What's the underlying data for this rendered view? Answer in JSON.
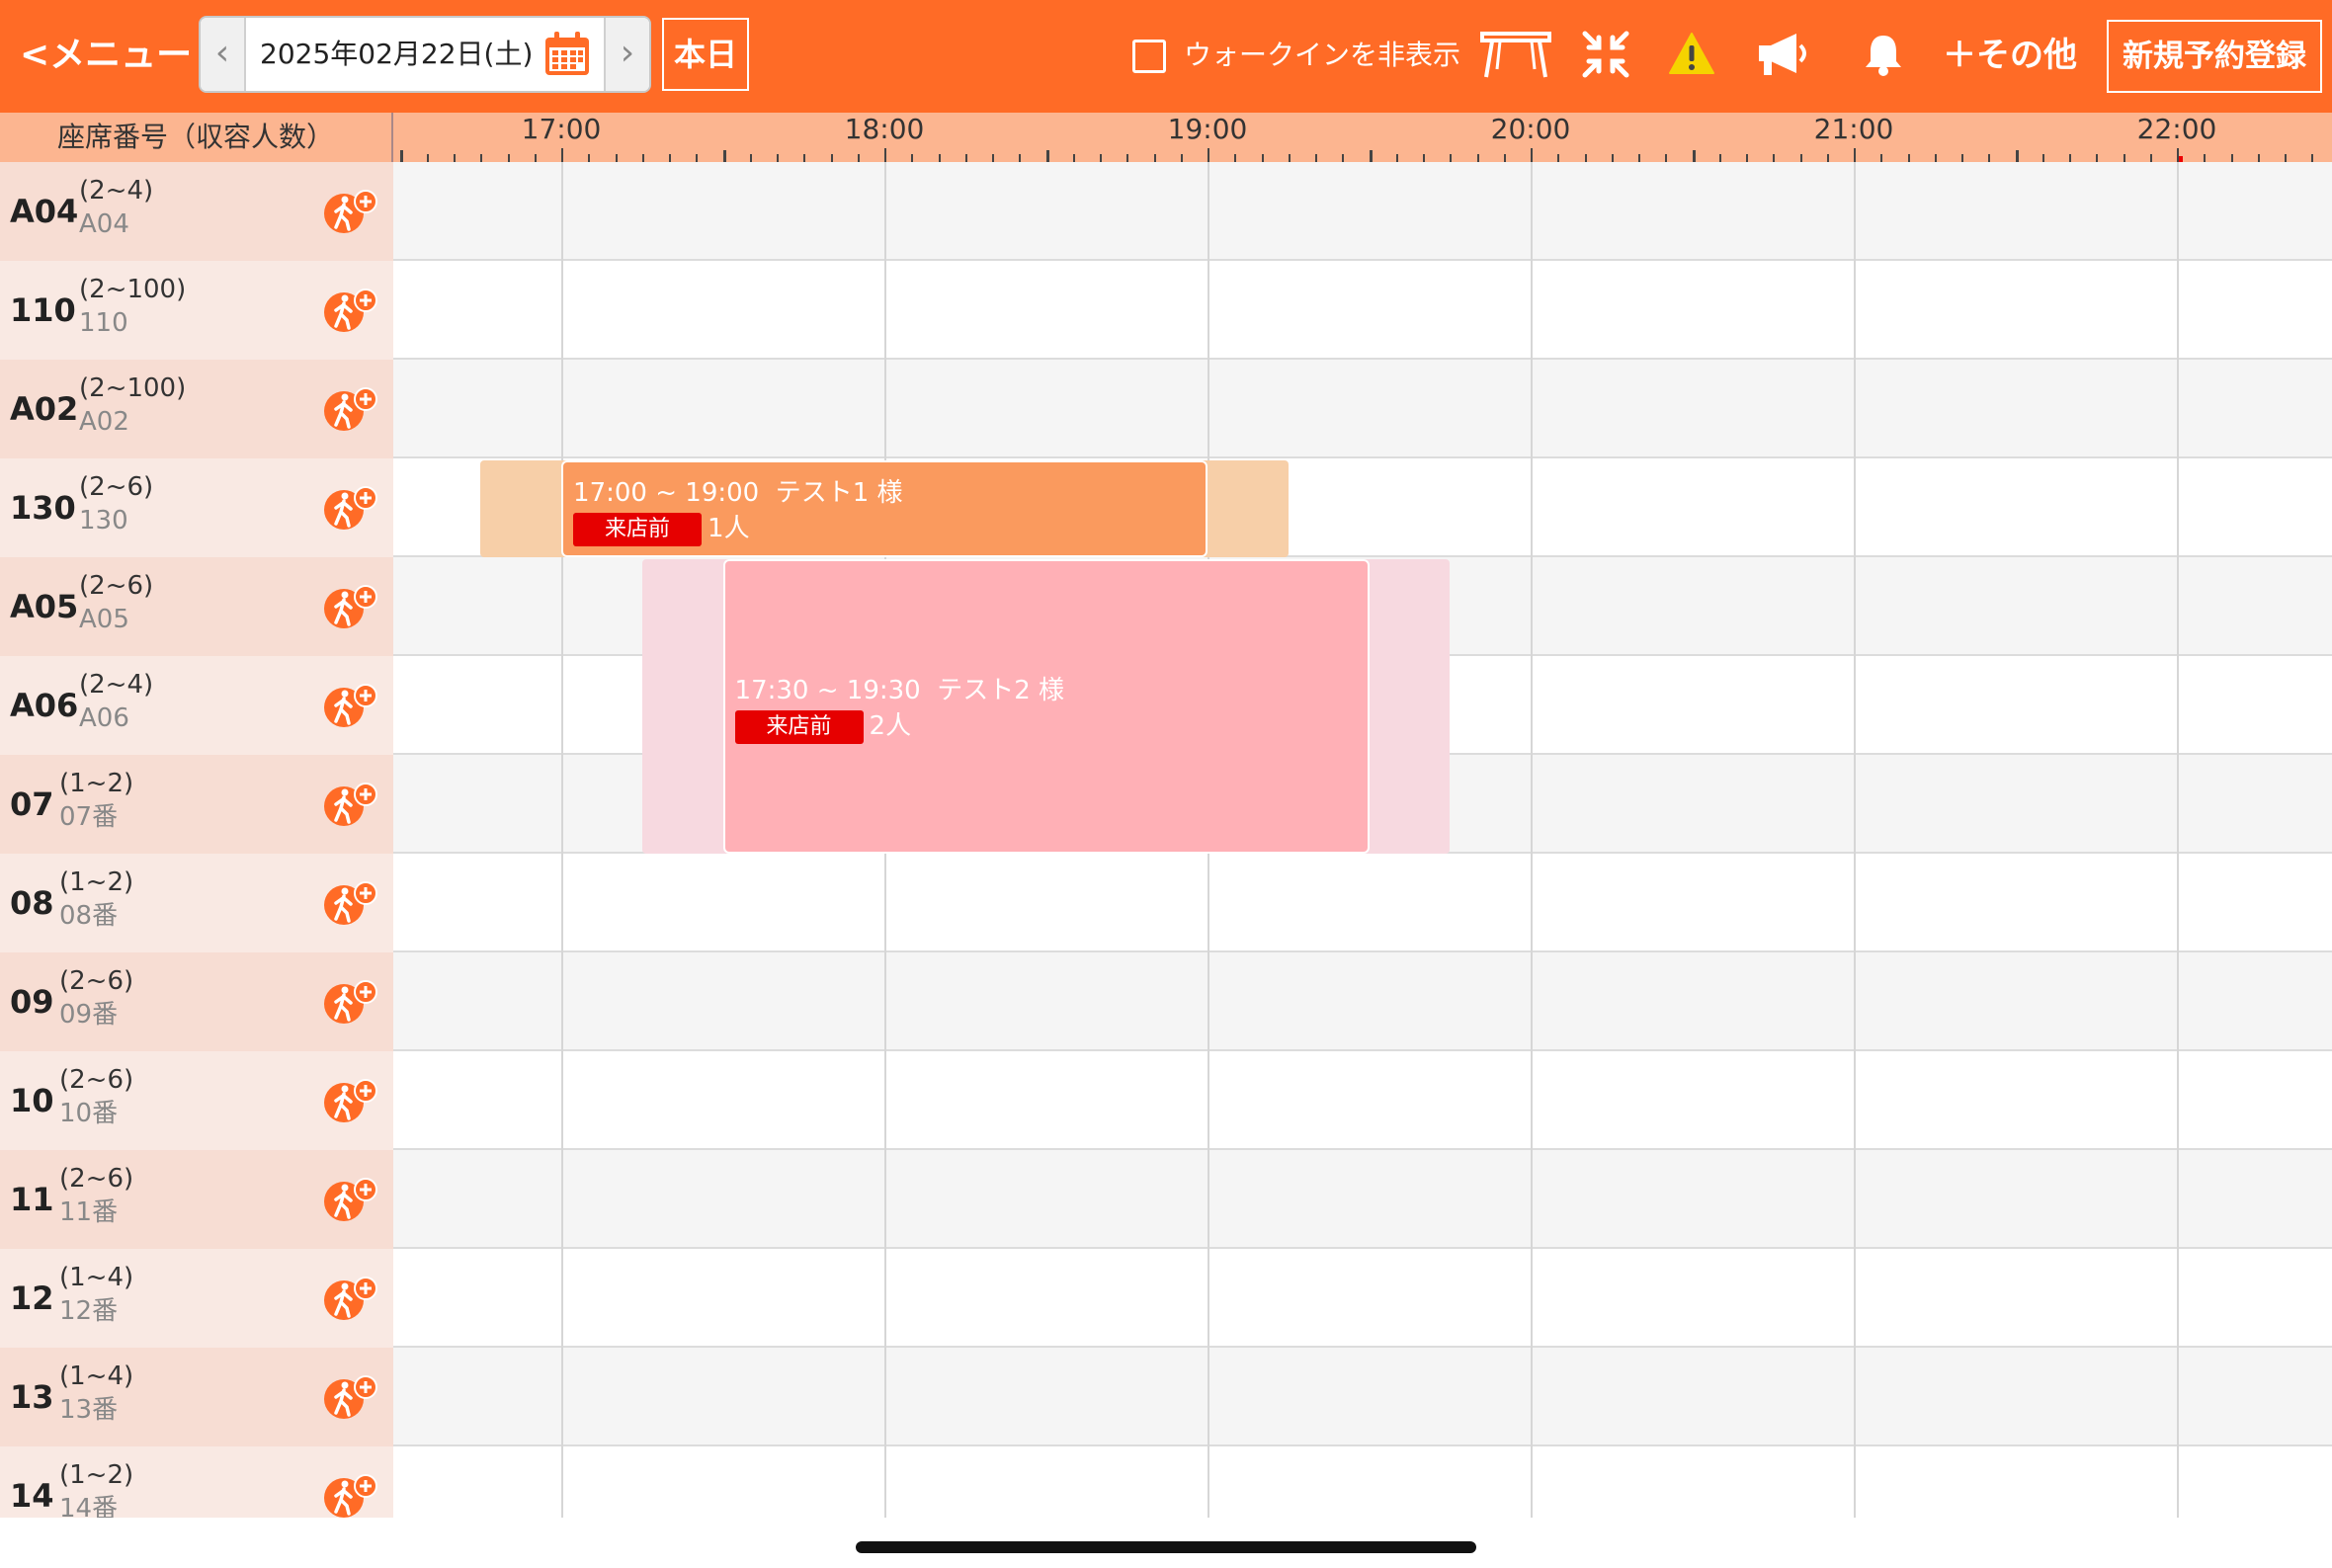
{
  "topbar": {
    "menu_label": "<メニュー",
    "date": "2025年02月22日(土)",
    "today_label": "本日",
    "walkin_hide_label": "ウォークインを非表示",
    "walkin_hide_checked": false,
    "other_label": "その他",
    "new_reservation_label": "新規予約登録",
    "icons": [
      "chevron-left-icon",
      "chevron-right-icon",
      "calendar-icon",
      "table-icon",
      "collapse-icon",
      "warning-icon",
      "megaphone-icon",
      "bell-icon",
      "plus-icon"
    ]
  },
  "timeline": {
    "seat_header": "座席番号（収容人数）",
    "hours": [
      "17:00",
      "18:00",
      "19:00",
      "20:00",
      "21:00",
      "22:00"
    ],
    "start_hour": 16.48,
    "end_hour": 22.53,
    "now": "22:00"
  },
  "seats": [
    {
      "name": "A04",
      "capacity": "(2~4)",
      "sub": "A04"
    },
    {
      "name": "110",
      "capacity": "(2~100)",
      "sub": "110"
    },
    {
      "name": "A02",
      "capacity": "(2~100)",
      "sub": "A02"
    },
    {
      "name": "130",
      "capacity": "(2~6)",
      "sub": "130"
    },
    {
      "name": "A05",
      "capacity": "(2~6)",
      "sub": "A05"
    },
    {
      "name": "A06",
      "capacity": "(2~4)",
      "sub": "A06"
    },
    {
      "name": "07",
      "capacity": "(1~2)",
      "sub": "07番"
    },
    {
      "name": "08",
      "capacity": "(1~2)",
      "sub": "08番"
    },
    {
      "name": "09",
      "capacity": "(2~6)",
      "sub": "09番"
    },
    {
      "name": "10",
      "capacity": "(2~6)",
      "sub": "10番"
    },
    {
      "name": "11",
      "capacity": "(2~6)",
      "sub": "11番"
    },
    {
      "name": "12",
      "capacity": "(1~4)",
      "sub": "12番"
    },
    {
      "name": "13",
      "capacity": "(1~4)",
      "sub": "13番"
    },
    {
      "name": "14",
      "capacity": "(1~2)",
      "sub": "14番"
    }
  ],
  "reservations": [
    {
      "time": "17:00 ~ 19:00",
      "guest": "テスト1 様",
      "status": "来店前",
      "party": "1人",
      "start_hour": 17.0,
      "end_hour": 19.0,
      "buffer_start_hour": 16.75,
      "buffer_end_hour": 19.25,
      "seats": [
        "130"
      ],
      "color": "#fa9a5e",
      "buffer_color": "#f7cfa8"
    },
    {
      "time": "17:30 ~ 19:30",
      "guest": "テスト2 様",
      "status": "来店前",
      "party": "2人",
      "start_hour": 17.5,
      "end_hour": 19.5,
      "buffer_start_hour": 17.25,
      "buffer_end_hour": 19.75,
      "seats": [
        "A05",
        "A06",
        "07"
      ],
      "color": "#ffb0b6",
      "buffer_color": "#f7d9e0"
    }
  ],
  "colors": {
    "accent": "#ff6b26",
    "header_bg": "#fcb590",
    "status_badge": "#e60000"
  }
}
